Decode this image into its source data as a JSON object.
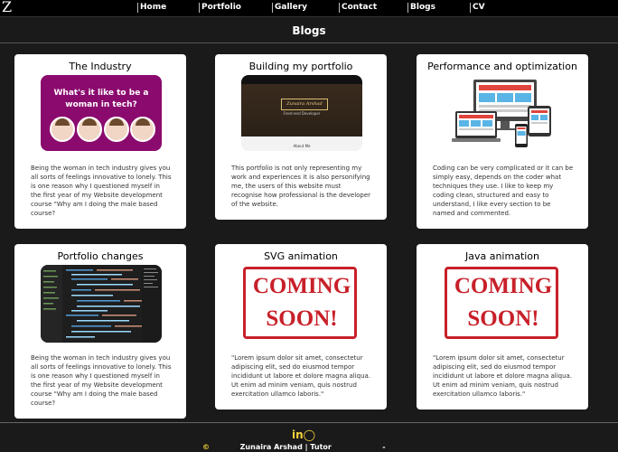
{
  "header": {
    "logo": "Z",
    "nav": [
      {
        "label": "Home"
      },
      {
        "label": "Portfolio"
      },
      {
        "label": "Gallery"
      },
      {
        "label": "Contact"
      },
      {
        "label": "Blogs"
      },
      {
        "label": "CV"
      }
    ]
  },
  "page": {
    "title": "Blogs"
  },
  "cards": [
    {
      "title": "The Industry",
      "image_text_1": "What's it like to be a",
      "image_text_2": "woman in tech?",
      "text": "Being the woman in tech industry gives you all sorts of feelings innovative to lonely. This is one reason why I questioned myself in the first year of my Website development course \"Why am I doing the male based course?"
    },
    {
      "title": "Building my portfolio",
      "image_name": "Zunaira Arshad",
      "image_sub": "Front-end Developer",
      "image_footer": "About Me",
      "text": "This portfolio is not only representing my work and experiences it is also personifying me, the users of this website must recognise how professional is the developer of the website."
    },
    {
      "title": "Performance and optimization",
      "text": "Coding can be very complicated or it can be simply easy, depends on the coder what techniques they use. I like to keep my coding clean, structured and easy to understand, I like every section to be named and commented."
    },
    {
      "title": "Portfolio changes",
      "text": "Being the woman in tech industry gives you all sorts of feelings innovative to lonely. This is one reason why I questioned myself in the first year of my Website development course \"Why am I doing the male based course?"
    },
    {
      "title": "SVG animation",
      "image_text_1": "COMING",
      "image_text_2": "SOON!",
      "text": "\"Lorem ipsum dolor sit amet, consectetur adipiscing elit, sed do eiusmod tempor incididunt ut labore et dolore magna aliqua. Ut enim ad minim veniam, quis nostrud exercitation ullamco laboris.\""
    },
    {
      "title": "Java animation",
      "image_text_1": "COMING",
      "image_text_2": "SOON!",
      "text": "\"Lorem ipsum dolor sit amet, consectetur adipiscing elit, sed do eiusmod tempor incididunt ut labore et dolore magna aliqua. Ut enim ad minim veniam, quis nostrud exercitation ullamco laboris.\""
    }
  ],
  "footer": {
    "icons": [
      "linkedin-icon",
      "github-icon"
    ],
    "linkedin_glyph": "in",
    "github_glyph": "◯",
    "copyright": "©",
    "name": "Zunaira Arshad | Tutor",
    "separator": "-"
  },
  "colors": {
    "background": "#1a1a1a",
    "card": "#ffffff",
    "accent_yellow": "#f5d43a",
    "coming_soon_red": "#c8202a",
    "woman_tech_purple": "#8b0a6e"
  }
}
